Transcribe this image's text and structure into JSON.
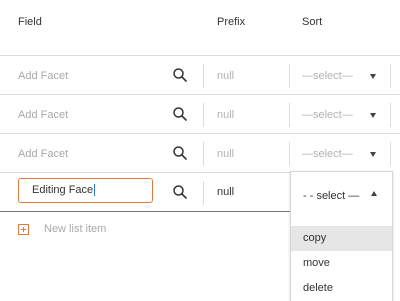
{
  "headers": {
    "field": "Field",
    "prefix": "Prefix",
    "sort": "Sort"
  },
  "rows": [
    {
      "field_placeholder": "Add Facet",
      "prefix": "null",
      "sort": "—select—"
    },
    {
      "field_placeholder": "Add Facet",
      "prefix": "null",
      "sort": "—select—"
    },
    {
      "field_placeholder": "Add Facet",
      "prefix": "null",
      "sort": "—select—"
    }
  ],
  "editing_row": {
    "field_value": "Editing Face",
    "prefix": "null",
    "sort_selected": "- - select —",
    "sort_options": [
      "copy",
      "move",
      "delete"
    ],
    "highlighted_option": "copy"
  },
  "new_item_label": "New list item",
  "colors": {
    "accent": "#e07a3e",
    "cursor": "#2a7ad6",
    "divider": "#dcdcdc",
    "placeholder": "#a9a9a9"
  },
  "icons": {
    "search": "search-icon",
    "caret": "chevron-down-icon",
    "caret_open": "chevron-up-icon",
    "add": "plus-square-icon"
  }
}
